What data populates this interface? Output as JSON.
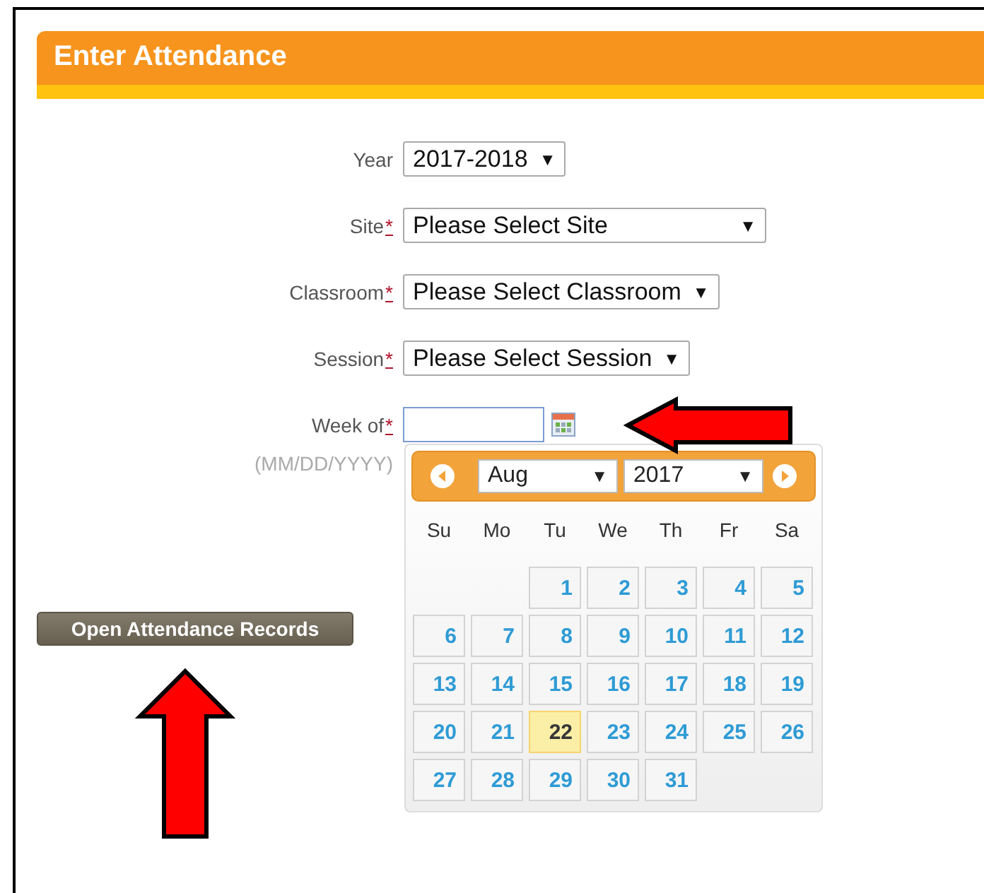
{
  "panel": {
    "title": "Enter Attendance"
  },
  "fields": [
    {
      "kind": "select",
      "label": "Year",
      "value": "2017-2018",
      "arrow": "▼"
    },
    {
      "kind": "select",
      "label": "Site",
      "required_mark": "*",
      "value": "Please Select Site",
      "arrow": "▼",
      "wide": true
    },
    {
      "kind": "select",
      "label": "Classroom",
      "required_mark": "*",
      "value": "Please Select Classroom",
      "arrow": "▼"
    },
    {
      "kind": "select",
      "label": "Session",
      "required_mark": "*",
      "value": "Please Select Session",
      "arrow": "▼"
    },
    {
      "kind": "date",
      "label": "Week of",
      "required_mark": "*",
      "hint": "(MM/DD/YYYY)"
    }
  ],
  "datepicker": {
    "month": "Aug",
    "year": "2017",
    "arrow": "▼",
    "weekdays": [
      "Su",
      "Mo",
      "Tu",
      "We",
      "Th",
      "Fr",
      "Sa"
    ],
    "weeks": [
      {
        "days": [
          {
            "day": "1",
            "selected": false
          },
          {
            "day": "2",
            "selected": false
          },
          {
            "day": "3",
            "selected": false
          },
          {
            "day": "4",
            "selected": false
          },
          {
            "day": "5",
            "selected": false
          }
        ]
      },
      {
        "days": [
          {
            "day": "6",
            "selected": false
          },
          {
            "day": "7",
            "selected": false
          },
          {
            "day": "8",
            "selected": false
          },
          {
            "day": "9",
            "selected": false
          },
          {
            "day": "10",
            "selected": false
          },
          {
            "day": "11",
            "selected": false
          },
          {
            "day": "12",
            "selected": false
          }
        ]
      },
      {
        "days": [
          {
            "day": "13",
            "selected": false
          },
          {
            "day": "14",
            "selected": false
          },
          {
            "day": "15",
            "selected": false
          },
          {
            "day": "16",
            "selected": false
          },
          {
            "day": "17",
            "selected": false
          },
          {
            "day": "18",
            "selected": false
          },
          {
            "day": "19",
            "selected": false
          }
        ]
      },
      {
        "days": [
          {
            "day": "20",
            "selected": false
          },
          {
            "day": "21",
            "selected": false
          },
          {
            "day": "22",
            "selected": true
          },
          {
            "day": "23",
            "selected": false
          },
          {
            "day": "24",
            "selected": false
          },
          {
            "day": "25",
            "selected": false
          },
          {
            "day": "26",
            "selected": false
          }
        ]
      },
      {
        "days": [
          {
            "day": "27",
            "selected": false
          },
          {
            "day": "28",
            "selected": false
          },
          {
            "day": "29",
            "selected": false
          },
          {
            "day": "30",
            "selected": false
          },
          {
            "day": "31",
            "selected": false
          }
        ]
      }
    ]
  },
  "button": {
    "label": "Open Attendance Records"
  }
}
